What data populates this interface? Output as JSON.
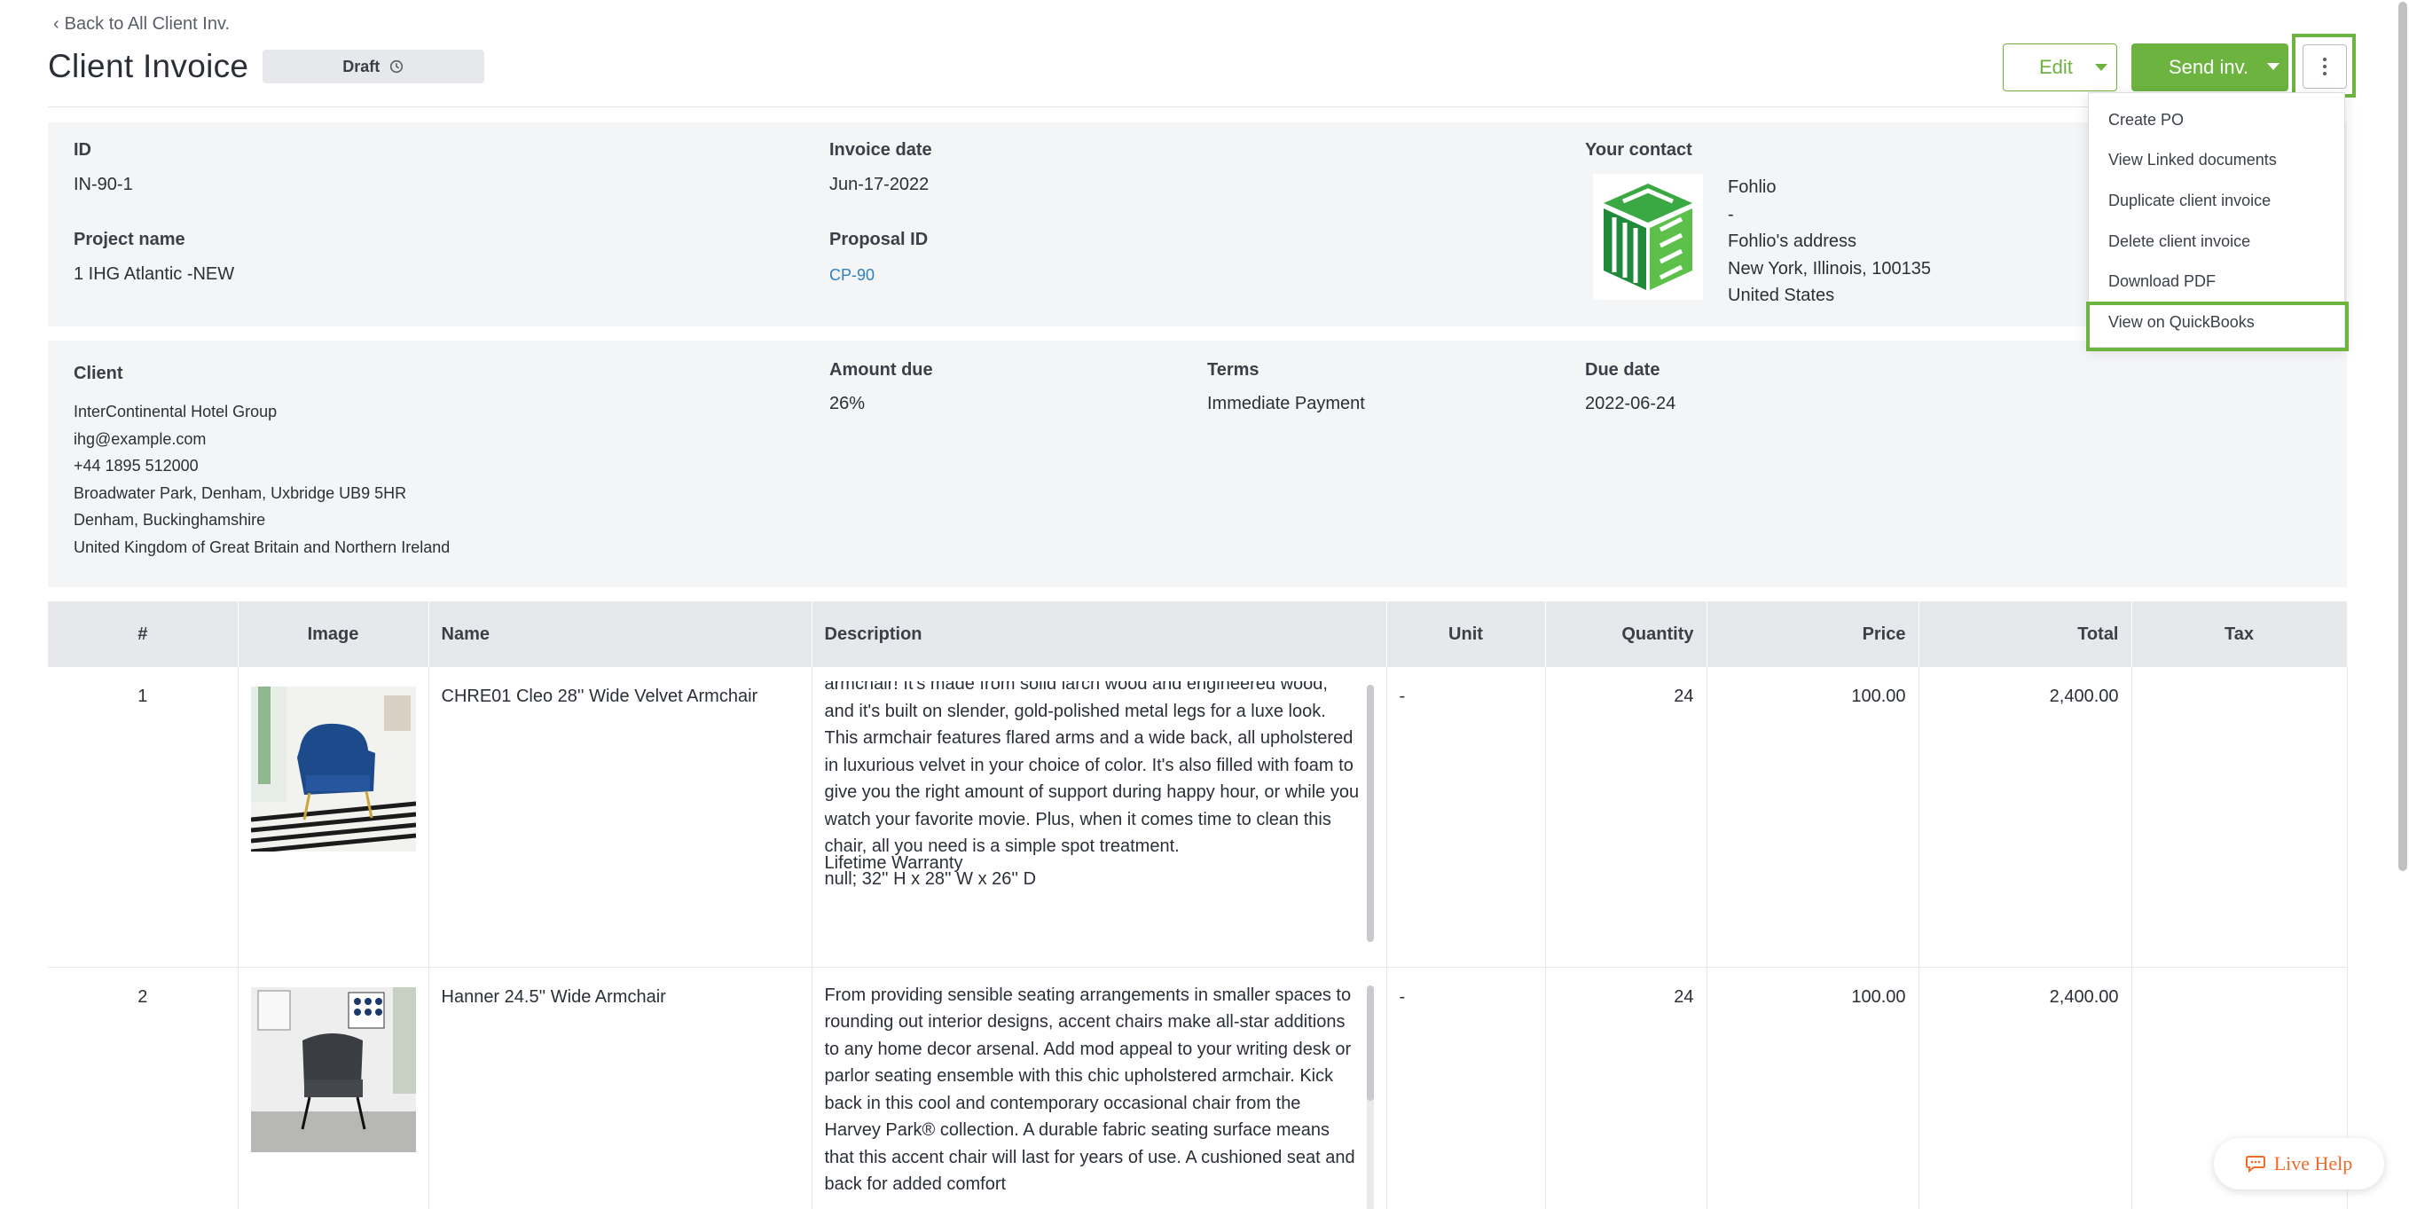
{
  "nav": {
    "back_label": "Back to All Client Inv."
  },
  "header": {
    "title": "Client Invoice",
    "status": "Draft",
    "edit_label": "Edit",
    "send_label": "Send inv."
  },
  "menu": {
    "items": [
      "Create PO",
      "View Linked documents",
      "Duplicate client invoice",
      "Delete client invoice",
      "Download PDF",
      "View on QuickBooks"
    ],
    "highlighted": "View on QuickBooks"
  },
  "details": {
    "id_label": "ID",
    "id_value": "IN-90-1",
    "invoice_date_label": "Invoice date",
    "invoice_date_value": "Jun-17-2022",
    "contact_label": "Your contact",
    "project_label": "Project name",
    "project_value": "1 IHG Atlantic -NEW",
    "proposal_label": "Proposal ID",
    "proposal_value": "CP-90",
    "contact_lines": [
      "Fohlio",
      "-",
      "Fohlio's address",
      "New York, Illinois, 100135",
      "United States"
    ]
  },
  "billing": {
    "client_label": "Client",
    "client_lines": [
      "InterContinental Hotel Group",
      "ihg@example.com",
      "+44 1895 512000",
      "Broadwater Park, Denham, Uxbridge UB9 5HR",
      "Denham, Buckinghamshire",
      "United Kingdom of Great Britain and Northern Ireland"
    ],
    "amount_due_label": "Amount due",
    "amount_due_value": "26%",
    "terms_label": "Terms",
    "terms_value": "Immediate Payment",
    "due_date_label": "Due date",
    "due_date_value": "2022-06-24"
  },
  "table": {
    "headers": [
      "#",
      "Image",
      "Name",
      "Description",
      "Unit",
      "Quantity",
      "Price",
      "Total",
      "Tax"
    ],
    "rows": [
      {
        "num": "1",
        "name": "CHRE01 Cleo 28'' Wide Velvet Armchair",
        "description": "armchair! It's made from solid larch wood and engineered wood, and it's built on slender, gold-polished metal legs for a luxe look. This armchair features flared arms and a wide back, all upholstered in luxurious velvet in your choice of color. It's also filled with foam to give you the right amount of support during happy hour, or while you watch your favorite movie. Plus, when it comes time to clean this chair, all you need is a simple spot treatment.",
        "description_extra_1": "Lifetime Warranty",
        "description_extra_2": "null; 32'' H x 28'' W x 26'' D",
        "unit": "-",
        "quantity": "24",
        "price": "100.00",
        "total": "2,400.00",
        "tax": ""
      },
      {
        "num": "2",
        "name": "Hanner 24.5'' Wide Armchair",
        "description": "From providing sensible seating arrangements in smaller spaces to rounding out interior designs, accent chairs make all-star additions to any home decor arsenal. Add mod appeal to your writing desk or parlor seating ensemble with this chic upholstered armchair. Kick back in this cool and contemporary occasional chair from the Harvey Park® collection. A durable fabric seating surface means that this accent chair will last for years of use. A cushioned seat and back for added comfort",
        "unit": "-",
        "quantity": "24",
        "price": "100.00",
        "total": "2,400.00",
        "tax": ""
      }
    ]
  },
  "live_help": {
    "label": "Live Help"
  },
  "colors": {
    "accent": "#6db33f",
    "link": "#2f80c4",
    "panel": "#f4f5f7",
    "help": "#f06a2a"
  }
}
